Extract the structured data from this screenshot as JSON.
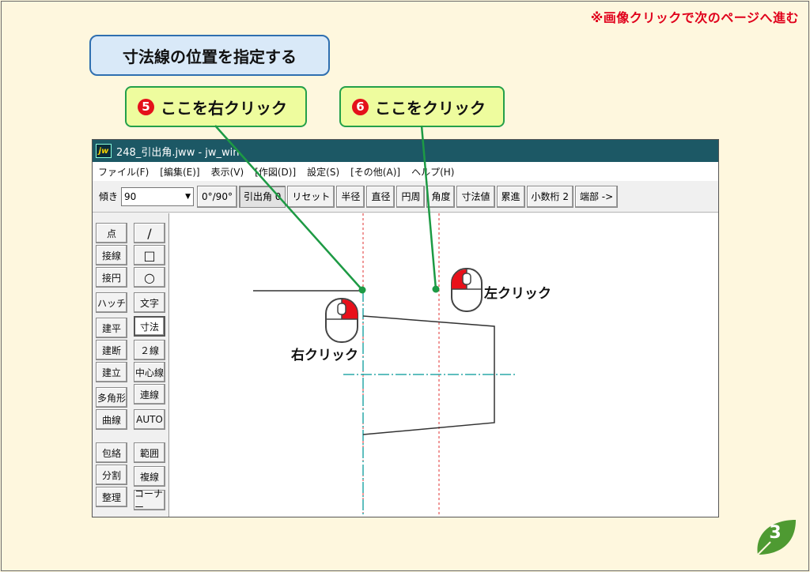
{
  "next_page_note": "※画像クリックで次のページへ進む",
  "step_title": "寸法線の位置を指定する",
  "callouts": [
    {
      "num": "5",
      "text": "ここを右クリック"
    },
    {
      "num": "6",
      "text": "ここをクリック"
    }
  ],
  "window": {
    "logo": "jw",
    "title": "248_引出角.jww - jw_win"
  },
  "menu": [
    "ファイル(F)",
    "[編集(E)]",
    "表示(V)",
    "[作図(D)]",
    "設定(S)",
    "[その他(A)]",
    "ヘルプ(H)"
  ],
  "toolbar": {
    "angle_label": "傾き",
    "angle_value": "90",
    "buttons": [
      "0°/90°",
      "引出角 0",
      "リセット",
      "半径",
      "直径",
      "円周",
      "角度",
      "寸法値",
      "累進",
      "小数桁 2",
      "端部 ->"
    ],
    "pressed_button": "引出角 0"
  },
  "tools_col1": [
    "点",
    "接線",
    "接円",
    "ハッチ",
    "建平",
    "建断",
    "建立",
    "多角形",
    "曲線",
    "包絡",
    "分割",
    "整理"
  ],
  "tools_col2": [
    "/",
    "□",
    "○",
    "文字",
    "寸法",
    "２線",
    "中心線",
    "連線",
    "AUTO",
    "範囲",
    "複線",
    "コーナー"
  ],
  "tools_col2_icons": [
    "line-icon",
    "rectangle-icon",
    "circle-icon"
  ],
  "active_tool": "寸法",
  "mouse_labels": {
    "right_click": "右クリック",
    "left_click": "左クリック"
  },
  "page_number": "3",
  "colors": {
    "background": "#fef7de",
    "accent_red": "#e0001b",
    "callout_green": "#24a04a",
    "callout_fill": "#eefc9e",
    "title_blue": "#2f6fb0",
    "titlebar": "#1c5865",
    "guide_red": "#e03030",
    "center_line": "#2aa8a8",
    "leaf_green": "#4e9a32"
  }
}
